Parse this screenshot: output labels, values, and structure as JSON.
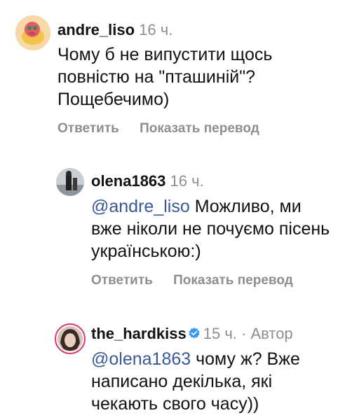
{
  "comments": [
    {
      "username": "andre_liso",
      "time": "16 ч.",
      "text": "Чому б не випустити щось повністю на \"пташиній\"? Пощебечимо)",
      "reply": "Ответить",
      "translate": "Показать перевод"
    },
    {
      "username": "olena1863",
      "time": "16 ч.",
      "mention": "@andre_liso",
      "text": "Можливо, ми вже ніколи не почуємо пісень українською:)",
      "reply": "Ответить",
      "translate": "Показать перевод"
    },
    {
      "username": "the_hardkiss",
      "time": "15 ч.",
      "separator": "·",
      "author_label": "Автор",
      "mention": "@olena1863",
      "text": "чому ж? Вже написано декілька, які чекають свого часу))"
    }
  ],
  "colors": {
    "mention": "#385898",
    "meta": "#8e8e8e",
    "verified": "#3897f0"
  }
}
